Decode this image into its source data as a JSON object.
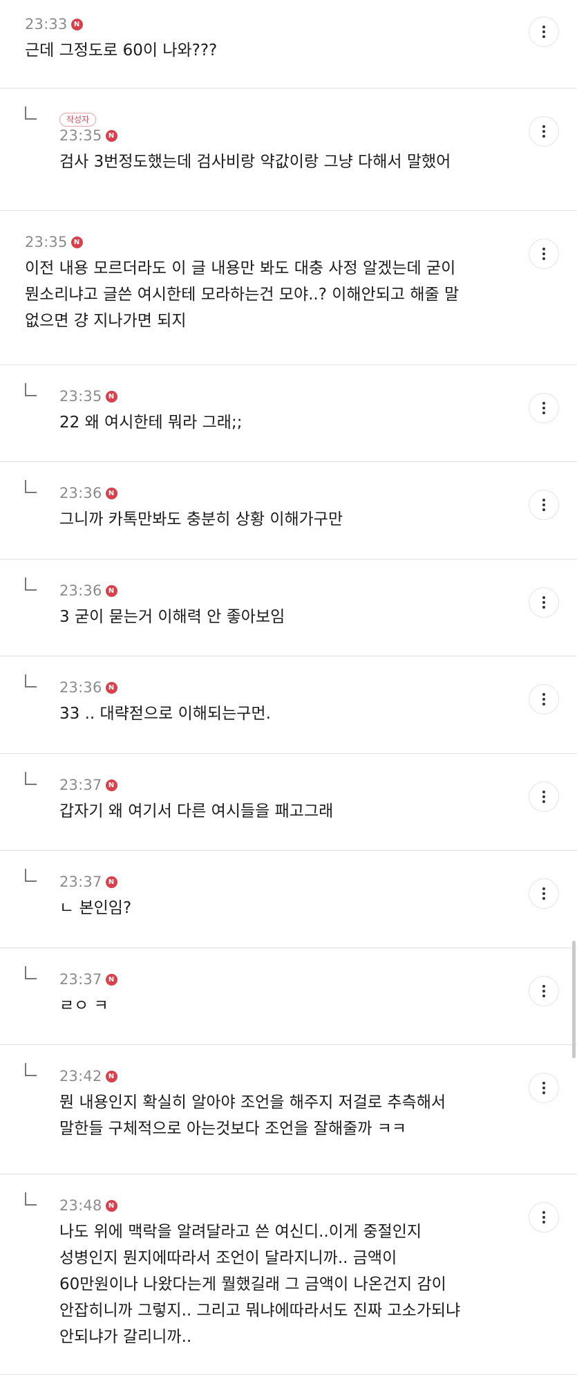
{
  "comments": [
    {
      "type": "top",
      "time": "23:33",
      "new": "N",
      "text": "근데 그정도로 60이 나와???"
    },
    {
      "type": "reply",
      "badge": "작성자",
      "time": "23:35",
      "new": "N",
      "text": "검사 3번정도했는데 검사비랑 약값이랑 그냥 다해서 말했어"
    },
    {
      "type": "top",
      "time": "23:35",
      "new": "N",
      "text": "이전 내용 모르더라도 이 글 내용만 봐도 대충 사정 알겠는데 굳이\n뭔소리냐고 글쓴 여시한테 모라하는건 모야..? 이해안되고 해줄 말\n없으면 걍 지나가면 되지"
    },
    {
      "type": "reply",
      "time": "23:35",
      "new": "N",
      "text": "22 왜 여시한테 뭐라 그래;;"
    },
    {
      "type": "reply",
      "time": "23:36",
      "new": "N",
      "text": "그니까 카톡만봐도 충분히 상황 이해가구만"
    },
    {
      "type": "reply",
      "time": "23:36",
      "new": "N",
      "text": "3 굳이 묻는거 이해력 안 좋아보임"
    },
    {
      "type": "reply",
      "time": "23:36",
      "new": "N",
      "text": "33 .. 대략젇으로 이해되는구먼."
    },
    {
      "type": "reply",
      "time": "23:37",
      "new": "N",
      "text": "갑자기 왜 여기서 다른 여시들을 패고그래"
    },
    {
      "type": "reply",
      "time": "23:37",
      "new": "N",
      "text": "ㄴ 본인임?"
    },
    {
      "type": "reply",
      "time": "23:37",
      "new": "N",
      "text": "ㄹㅇ ㅋ"
    },
    {
      "type": "reply",
      "time": "23:42",
      "new": "N",
      "text": "뭔 내용인지 확실히 알아야 조언을 해주지 저걸로 추측해서\n말한들 구체적으로 아는것보다 조언을 잘해줄까 ㅋㅋ"
    },
    {
      "type": "reply",
      "time": "23:48",
      "new": "N",
      "text": "나도 위에 맥락을 알려달라고 쓴 여신디..이게 중절인지\n성병인지 뭔지에따라서 조언이 달라지니까.. 금액이\n60만원이나 나왔다는게 뭘했길래 그 금액이 나온건지 감이\n안잡히니까 그렇지.. 그리고 뭐냐에따라서도 진짜 고소가되냐\n안되냐가 갈리니까.."
    }
  ],
  "more_button_icon": "more-vertical-icon",
  "reply_icon": "reply-corner-icon",
  "colors": {
    "new_badge": "#d9404b",
    "author_badge": "#d0525d",
    "time": "#8c8c8c",
    "divider": "#e2e2e2"
  }
}
